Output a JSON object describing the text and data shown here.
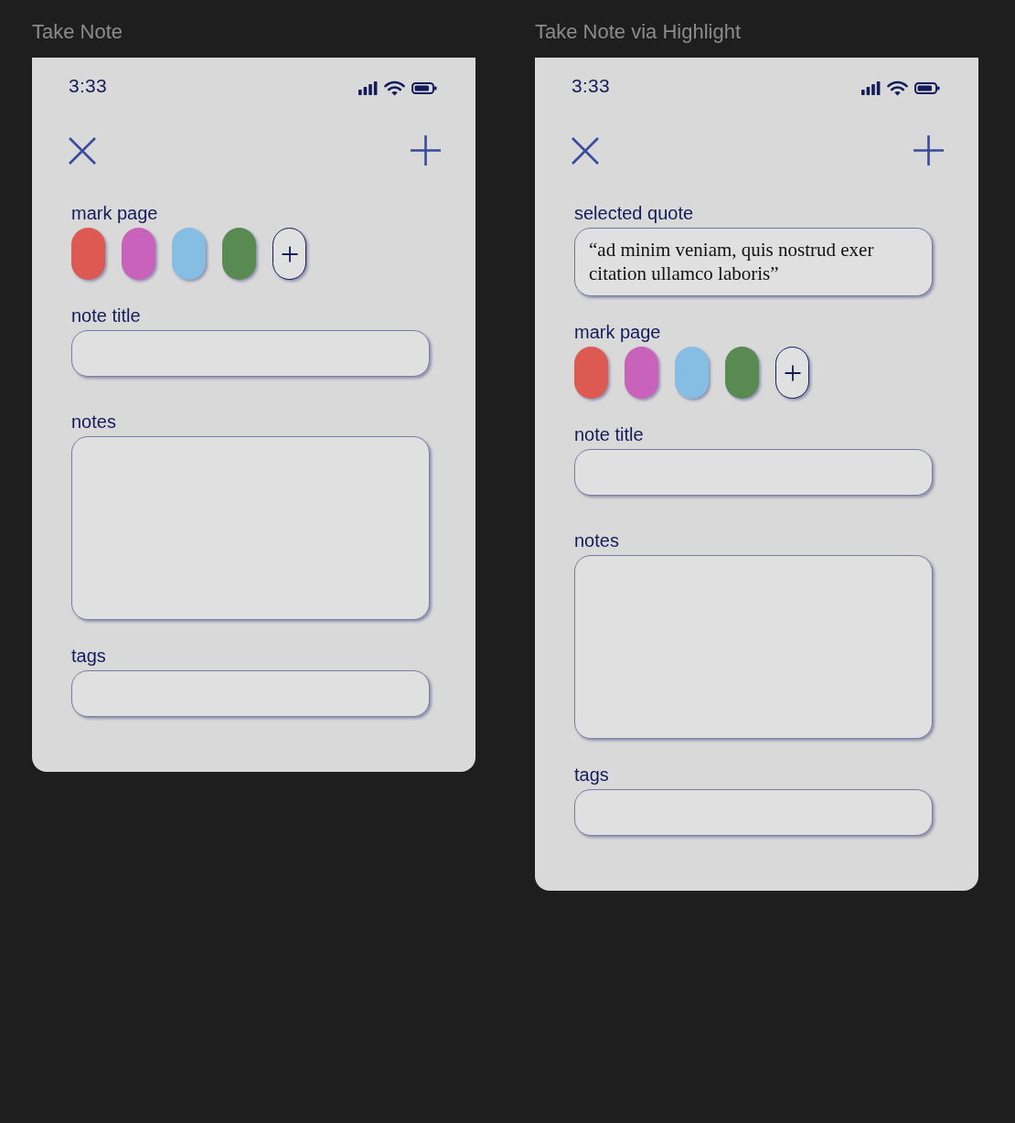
{
  "frames": [
    {
      "title": "Take Note",
      "status_bar": {
        "time": "3:33"
      },
      "sections": [
        {
          "kind": "swatches",
          "label": "mark page",
          "colors": [
            {
              "color": "#dc5a52"
            },
            {
              "color": "#c862bb"
            },
            {
              "color": "#85bde3"
            },
            {
              "color": "#588a52"
            }
          ]
        },
        {
          "kind": "input",
          "label": "note title"
        },
        {
          "kind": "textarea",
          "label": "notes"
        },
        {
          "kind": "input",
          "label": "tags"
        }
      ]
    },
    {
      "title": "Take Note via Highlight",
      "status_bar": {
        "time": "3:33"
      },
      "sections": [
        {
          "kind": "quote",
          "label": "selected quote",
          "text": "“ad minim veniam, quis nostrud exer citation ullamco laboris”"
        },
        {
          "kind": "swatches",
          "label": "mark page",
          "colors": [
            {
              "color": "#dc5a52"
            },
            {
              "color": "#c862bb"
            },
            {
              "color": "#85bde3"
            },
            {
              "color": "#588a52"
            }
          ]
        },
        {
          "kind": "input",
          "label": "note title"
        },
        {
          "kind": "textarea",
          "label": "notes"
        },
        {
          "kind": "input",
          "label": "tags"
        }
      ]
    }
  ]
}
